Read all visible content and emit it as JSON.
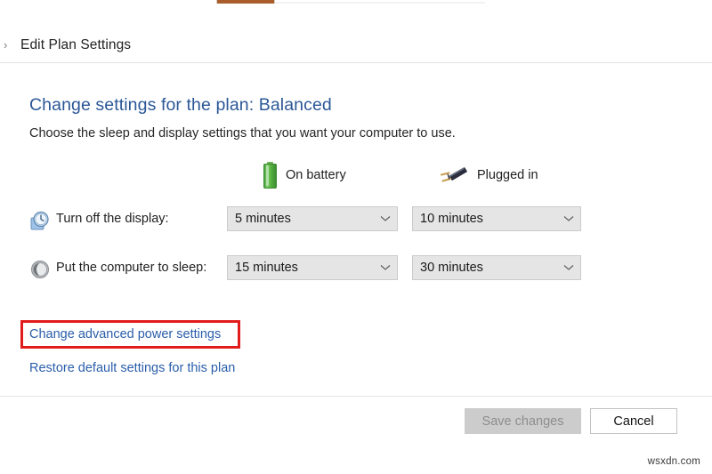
{
  "window": {
    "tab_fragment_color": "#a95d2b"
  },
  "breadcrumb": {
    "chevron": "›",
    "label": "Edit Plan Settings"
  },
  "main": {
    "title": "Change settings for the plan: Balanced",
    "subtitle": "Choose the sleep and display settings that you want your computer to use.",
    "columns": [
      {
        "icon": "battery-icon",
        "label": "On battery"
      },
      {
        "icon": "power-plug-icon",
        "label": "Plugged in"
      }
    ],
    "rows": [
      {
        "icon": "display-clock-icon",
        "label": "Turn off the display:",
        "on_battery": "5 minutes",
        "plugged_in": "10 minutes"
      },
      {
        "icon": "sleep-moon-icon",
        "label": "Put the computer to sleep:",
        "on_battery": "15 minutes",
        "plugged_in": "30 minutes"
      }
    ],
    "dropdown_arrow": "⌄",
    "links": [
      {
        "label": "Change advanced power settings",
        "highlighted": true
      },
      {
        "label": "Restore default settings for this plan",
        "highlighted": false
      }
    ]
  },
  "footer": {
    "save_label": "Save changes",
    "cancel_label": "Cancel"
  },
  "watermark": "wsxdn.com",
  "colors": {
    "title_blue": "#2b5797",
    "link_blue": "#2a5eaa",
    "highlight_red": "#e21b1b",
    "battery_green": "#57b341",
    "dropdown_bg": "#e5e5e5"
  }
}
